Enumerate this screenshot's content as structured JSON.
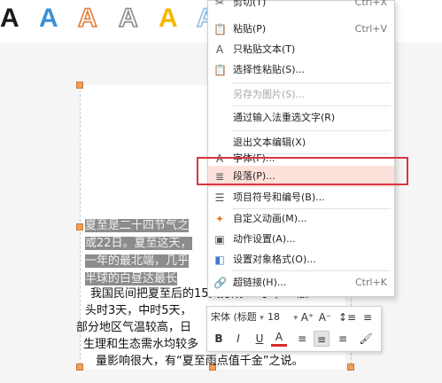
{
  "ribbon": {
    "wordart_styles": [
      {
        "glyph": "A",
        "color": "#1a1a1a"
      },
      {
        "glyph": "A",
        "color": "#3e8fd6"
      },
      {
        "glyph": "A",
        "color": "#e57a32"
      },
      {
        "glyph": "A",
        "color": "#8a8a8a"
      },
      {
        "glyph": "A",
        "color": "#f3b800"
      },
      {
        "glyph": "A",
        "color": "#8fbfe3"
      }
    ]
  },
  "slide": {
    "paragraph1": {
      "lines": [
        {
          "text": "夏至是二十四节气之"
        },
        {
          "text": "或22日。夏至这天，"
        },
        {
          "text": "一年的最北端，几乎"
        },
        {
          "text": "半球的白昼达最长"
        }
      ]
    },
    "paragraph2": {
      "lines": [
        {
          "text": "我国民间把夏至后的15天分成3“时”，一般"
        },
        {
          "text": "头时3天，中时5天，"
        },
        {
          "text": "部分地区气温较高，日"
        },
        {
          "text": "生理和生态需水均较多"
        },
        {
          "text": "量影响很大，有“夏至雨点值千金”之说。"
        }
      ]
    }
  },
  "context_menu": {
    "items": [
      {
        "icon": "cut-icon",
        "glyph": "✂",
        "label": "剪切(T)",
        "shortcut": "Ctrl+X",
        "disabled": false
      },
      {
        "icon": "paste-icon",
        "glyph": "📋",
        "label": "粘贴(P)",
        "shortcut": "Ctrl+V",
        "disabled": false
      },
      {
        "icon": "paste-text-icon",
        "glyph": "A",
        "label": "只粘贴文本(T)",
        "shortcut": "",
        "disabled": false
      },
      {
        "icon": "paste-special-icon",
        "glyph": "📋",
        "label": "选择性粘贴(S)...",
        "shortcut": "",
        "disabled": false
      },
      {
        "icon": "",
        "glyph": "",
        "label": "另存为图片(S)...",
        "shortcut": "",
        "disabled": true
      },
      {
        "icon": "",
        "glyph": "",
        "label": "通过输入法重选文字(R)",
        "shortcut": "",
        "disabled": false
      },
      {
        "icon": "",
        "glyph": "",
        "label": "退出文本编辑(X)",
        "shortcut": "",
        "disabled": false
      },
      {
        "icon": "font-icon",
        "glyph": "A",
        "label": "字体(F)...",
        "shortcut": "",
        "disabled": false
      },
      {
        "icon": "paragraph-icon",
        "glyph": "≣",
        "label": "段落(P)...",
        "shortcut": "",
        "disabled": false,
        "hovered": true
      },
      {
        "icon": "bullets-numbering-icon",
        "glyph": "☰",
        "label": "项目符号和编号(B)...",
        "shortcut": "",
        "disabled": false
      },
      {
        "icon": "custom-animation-icon",
        "glyph": "✦",
        "label": "自定义动画(M)...",
        "shortcut": "",
        "disabled": false
      },
      {
        "icon": "action-settings-icon",
        "glyph": "▣",
        "label": "动作设置(A)...",
        "shortcut": "",
        "disabled": false
      },
      {
        "icon": "object-format-icon",
        "glyph": "◧",
        "label": "设置对象格式(O)...",
        "shortcut": "",
        "disabled": false
      },
      {
        "icon": "hyperlink-icon",
        "glyph": "🔗",
        "label": "超链接(H)...",
        "shortcut": "Ctrl+K",
        "disabled": false
      }
    ]
  },
  "mini_toolbar": {
    "font_name": "宋体 (标题",
    "font_size": "18",
    "dropdown_glyph": "▾",
    "buttons_row1": [
      {
        "name": "grow-font-button",
        "glyph": "A⁺"
      },
      {
        "name": "shrink-font-button",
        "glyph": "A⁻"
      },
      {
        "name": "line-spacing-button",
        "glyph": "↕≡"
      },
      {
        "name": "para-spacing-button",
        "glyph": "≡"
      }
    ],
    "buttons_row2": [
      {
        "name": "bold-button",
        "glyph": "B"
      },
      {
        "name": "italic-button",
        "glyph": "I"
      },
      {
        "name": "underline-button",
        "glyph": "U"
      },
      {
        "name": "font-color-button",
        "glyph": "A"
      },
      {
        "name": "align-left-button",
        "glyph": "≡"
      },
      {
        "name": "align-center-button",
        "glyph": "≡",
        "active": true
      },
      {
        "name": "align-right-button",
        "glyph": "≡"
      },
      {
        "name": "format-painter-button",
        "glyph": "🖌"
      }
    ]
  },
  "colors": {
    "hover_bg": "#fde2dc",
    "annotation_box": "#d9363e",
    "selection_handle": "#f0a05a"
  }
}
